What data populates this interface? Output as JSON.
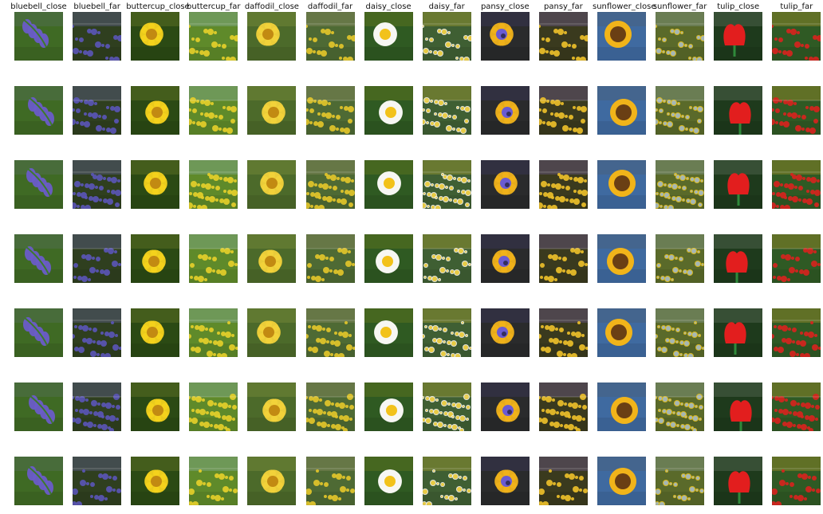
{
  "column_labels": [
    "bluebell_close",
    "bluebell_far",
    "buttercup_close",
    "buttercup_far",
    "daffodil_close",
    "daffodil_far",
    "daisy_close",
    "daisy_far",
    "pansy_close",
    "pansy_far",
    "sunflower_close",
    "sunflower_far",
    "tulip_close",
    "tulip_far"
  ],
  "row_count": 7,
  "palettes": {
    "bluebell_close": {
      "bg": "#3f6a24",
      "fg": "#6a5cc8",
      "accent": "#8d7ee0"
    },
    "bluebell_far": {
      "bg": "#2f3f1f",
      "fg": "#5b55b8",
      "accent": "#7b73d6"
    },
    "buttercup_close": {
      "bg": "#2b4a14",
      "fg": "#f4d21c",
      "accent": "#ffe45a"
    },
    "buttercup_far": {
      "bg": "#5f8a2a",
      "fg": "#e8d02a",
      "accent": "#9cc2e0"
    },
    "daffodil_close": {
      "bg": "#4c6a2a",
      "fg": "#f2d23a",
      "accent": "#f7e56a"
    },
    "daffodil_far": {
      "bg": "#4e6a34",
      "fg": "#e6c82a",
      "accent": "#b0a07a"
    },
    "daisy_close": {
      "bg": "#2f5a22",
      "fg": "#f7f7f2",
      "accent": "#f2c21a"
    },
    "daisy_far": {
      "bg": "#3f5f33",
      "fg": "#f2f2ee",
      "accent": "#e9c72a"
    },
    "pansy_close": {
      "bg": "#2a2b2c",
      "fg": "#f0b21a",
      "accent": "#6a5bd2"
    },
    "pansy_far": {
      "bg": "#3a3a1e",
      "fg": "#f0c22a",
      "accent": "#8a6ad6"
    },
    "sunflower_close": {
      "bg": "#3f6aa0",
      "fg": "#f0b41a",
      "accent": "#6a3f14"
    },
    "sunflower_far": {
      "bg": "#5a6a2a",
      "fg": "#e7c21c",
      "accent": "#9cb6cf"
    },
    "tulip_close": {
      "bg": "#1e3a1c",
      "fg": "#e21e1e",
      "accent": "#f2f2f2"
    },
    "tulip_far": {
      "bg": "#2f5a24",
      "fg": "#d9221e",
      "accent": "#f2b22a"
    }
  }
}
